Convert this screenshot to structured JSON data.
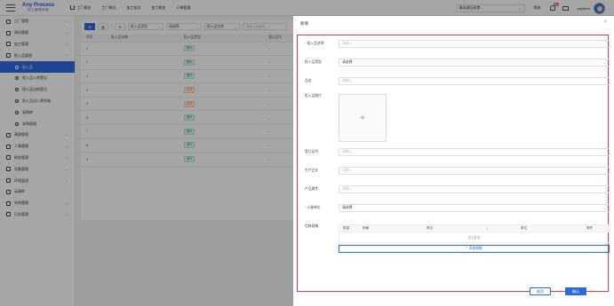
{
  "header": {
    "logo_title": "Any Process",
    "logo_sub": "加工管理系统",
    "nav": [
      "工厂概览",
      "工厂概况",
      "加工批次",
      "加工概览",
      "订单管理"
    ],
    "site_select": "青岛湖记码食...",
    "lang": "简体",
    "notice_count": "99",
    "user": "anyfarm"
  },
  "sidebar": {
    "items": [
      {
        "label": "工厂管理"
      },
      {
        "label": "原料管理"
      },
      {
        "label": "加工管理"
      },
      {
        "label": "投入品管理"
      },
      {
        "label": "投入品"
      },
      {
        "label": "投入品入库登记"
      },
      {
        "label": "投入品出库登记"
      },
      {
        "label": "投入品出入库台账"
      },
      {
        "label": "采购库"
      },
      {
        "label": "采购管理"
      },
      {
        "label": "溯源管理"
      },
      {
        "label": "人事管理"
      },
      {
        "label": "财务管理"
      },
      {
        "label": "设备管理"
      },
      {
        "label": "环境监测"
      },
      {
        "label": "云端库"
      },
      {
        "label": "系统管理"
      },
      {
        "label": "日志管理"
      }
    ]
  },
  "toolbar": {
    "filter1": "投入品类型",
    "filter2": "请选择",
    "filter3": "投入品名称",
    "search_placeholder": "请输入关键词"
  },
  "table": {
    "headers": [
      "序号",
      "投入品名称",
      "投入品类型",
      "登记证号"
    ],
    "rows": [
      {
        "no": "1",
        "name": "",
        "type": "肥料",
        "reg": "--"
      },
      {
        "no": "2",
        "name": "",
        "type": "肥料",
        "reg": "--"
      },
      {
        "no": "3",
        "name": "",
        "type": "肥料",
        "reg": "--"
      },
      {
        "no": "4",
        "name": "",
        "type": "农药",
        "reg": "--"
      },
      {
        "no": "5",
        "name": "",
        "type": "农药",
        "reg": "--"
      },
      {
        "no": "6",
        "name": "",
        "type": "肥料",
        "reg": "--"
      },
      {
        "no": "7",
        "name": "",
        "type": "肥料",
        "reg": "--"
      },
      {
        "no": "8",
        "name": "",
        "type": "肥料",
        "reg": "--"
      },
      {
        "no": "9",
        "name": "",
        "type": "肥料",
        "reg": "--"
      }
    ]
  },
  "drawer": {
    "title": "新增",
    "fields": {
      "name_label": "投入品名称",
      "name_placeholder": "请输入",
      "type_label": "投入品类型",
      "type_value": "请选择",
      "brand_label": "品名",
      "brand_placeholder": "请输入",
      "image_label": "投入品图片",
      "reg_label": "登记证号",
      "reg_placeholder": "请输入",
      "maker_label": "生产企业",
      "maker_placeholder": "请输入",
      "origin_label": "产品属性",
      "origin_placeholder": "请输入",
      "unit_label": "计量单位",
      "unit_value": "请选择",
      "pack_label": "包装规格"
    },
    "pack_headers": [
      "数量",
      "规格",
      "单位",
      "/",
      "单位",
      "操作"
    ],
    "pack_empty": "暂无数据",
    "add_spec": "+ 添加规格",
    "cancel": "取消",
    "confirm": "确认"
  }
}
